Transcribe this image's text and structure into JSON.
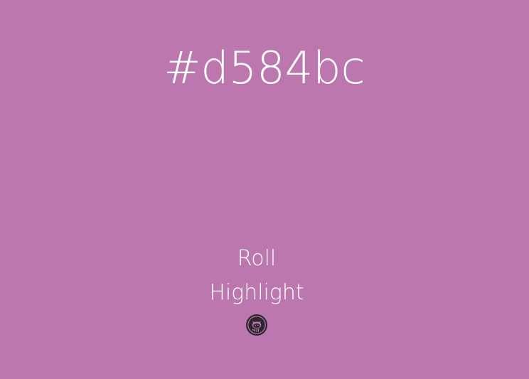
{
  "colors": {
    "background": "#bd77af",
    "text": "#ffffff",
    "icon": "#2d2830"
  },
  "header": {
    "hex_value": "#d584bc"
  },
  "controls": {
    "roll_label": "Roll",
    "highlight_label": "Highlight"
  },
  "footer": {
    "github_icon": "github-octocat-icon"
  }
}
